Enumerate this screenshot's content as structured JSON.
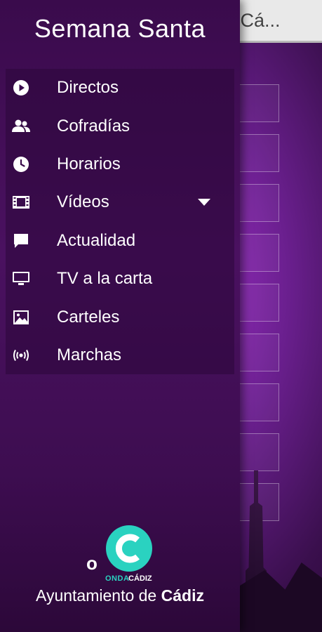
{
  "background_app": {
    "header_title": "e Cá..."
  },
  "drawer": {
    "title": "Semana Santa",
    "items": [
      {
        "label": "Directos",
        "icon": "play-circle-icon"
      },
      {
        "label": "Cofradías",
        "icon": "people-icon"
      },
      {
        "label": "Horarios",
        "icon": "clock-icon"
      },
      {
        "label": "Vídeos",
        "icon": "film-icon",
        "has_submenu": true
      },
      {
        "label": "Actualidad",
        "icon": "chat-bubble-icon"
      },
      {
        "label": "TV a la carta",
        "icon": "monitor-icon"
      },
      {
        "label": "Carteles",
        "icon": "image-icon"
      },
      {
        "label": "Marchas",
        "icon": "radio-waves-icon"
      }
    ]
  },
  "logo": {
    "o": "o",
    "onda": "ONDA",
    "cadiz": "CÁDIZ",
    "ayuntamiento": "Ayuntamiento de",
    "ayuntamiento_city": "Cádiz"
  },
  "colors": {
    "drawer_bg": "#3a0b4c",
    "accent_teal": "#2ad2c0",
    "text": "#ffffff"
  }
}
